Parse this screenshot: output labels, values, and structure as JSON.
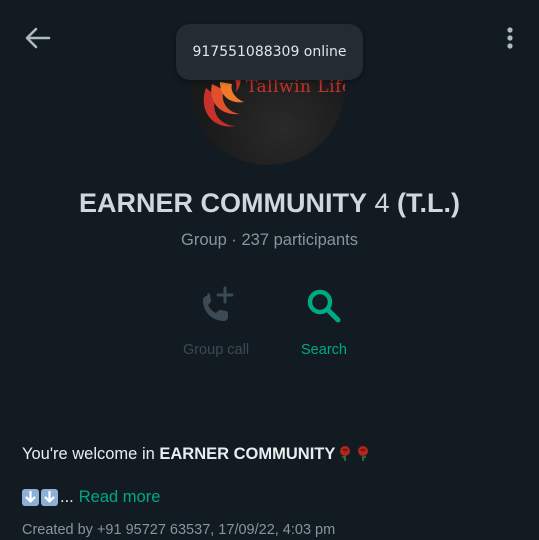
{
  "toast": {
    "text": "917551088309 online"
  },
  "avatar": {
    "brand_text": "Tallwin Life"
  },
  "group": {
    "name_main": "EARNER COMMUNITY",
    "name_suffix": " 4 ",
    "name_tag": "(T.L.)",
    "subtitle": "Group · 237 participants"
  },
  "actions": {
    "call_label": "Group call",
    "search_label": "Search"
  },
  "description": {
    "prefix": "You're welcome in ",
    "bold": "EARNER COMMUNITY",
    "ellipsis": "...",
    "read_more": "Read more",
    "created": "Created by +91 95727 63537, 17/09/22, 4:03 pm"
  },
  "colors": {
    "accent": "#00a884",
    "background": "#111b21",
    "muted_text": "#8696a0"
  },
  "icons": [
    "back-arrow-icon",
    "more-vertical-icon",
    "call-add-icon",
    "search-icon",
    "rose-icon",
    "down-arrow-icon"
  ]
}
